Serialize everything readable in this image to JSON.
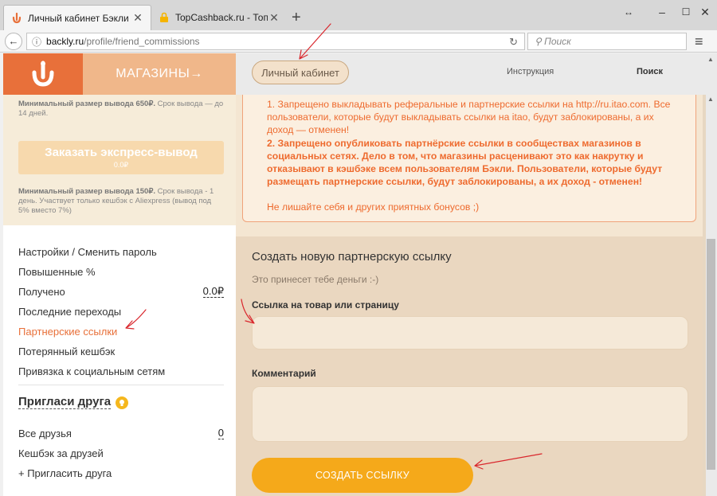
{
  "browser": {
    "tabs": [
      {
        "title": "Личный кабинет Бэкли",
        "active": true
      },
      {
        "title": "TopCashback.ru - Топ лу...",
        "active": false
      }
    ],
    "url_host": "backly.ru",
    "url_path": "/profile/friend_commissions",
    "search_placeholder": "Поиск"
  },
  "header": {
    "logo_glyph": "ᒍ",
    "stores_label": "МАГАЗИНЫ→",
    "nav": {
      "cabinet": "Личный кабинет",
      "instructions": "Инструкция",
      "search": "Поиск"
    }
  },
  "sidebar": {
    "note_top_bold": "Минимальный размер вывода 650₽.",
    "note_top_rest": " Срок вывода — до 14 дней.",
    "express_button": "Заказать экспресс-вывод",
    "express_amount": "0.0₽",
    "note_bottom_bold": "Минимальный размер вывода 150₽.",
    "note_bottom_rest": " Срок вывода - 1 день. Участвует только кешбэк с Aliexpress (вывод под 5% вместо 7%)",
    "menu": [
      {
        "label": "Настройки / Сменить пароль"
      },
      {
        "label": "Повышенные %"
      },
      {
        "label": "Получено",
        "value": "0.0₽"
      },
      {
        "label": "Последние переходы"
      },
      {
        "label": "Партнерские ссылки",
        "active": true
      },
      {
        "label": "Потерянный кешбэк"
      },
      {
        "label": "Привязка к социальным сетям"
      }
    ],
    "invite_title": "Пригласи друга",
    "invite_menu": [
      {
        "label": "Все друзья",
        "value": "0"
      },
      {
        "label": "Кешбэк за друзей"
      },
      {
        "label": "+ Пригласить друга"
      }
    ]
  },
  "notice": {
    "rule1": "1. Запрещено выкладывать реферальные и партнерские ссылки на http://ru.itao.com. Все пользователи, которые будут выкладывать ссылки на itao, будут заблокированы, а их доход — отменен!",
    "rule2": "2. Запрещено опубликовать партнёрские ссылки в сообществах магазинов в социальных сетях. Дело в том, что магазины расценивают это как накрутку и отказывают в кэшбэке всем пользователям Бэкли. Пользователи, которые будут размещать партнерские ссылки, будут заблокированы, а их доход - отменен!",
    "closing": "Не лишайте себя и других приятных бонусов ;)"
  },
  "form": {
    "title": "Создать новую партнерскую ссылку",
    "subtitle": "Это принесет тебе деньги :-)",
    "link_label": "Ссылка на товар или страницу",
    "link_value": "",
    "comment_label": "Комментарий",
    "comment_value": "",
    "submit_label": "СОЗДАТЬ ССЫЛКУ"
  },
  "colors": {
    "brand_orange": "#e8703a",
    "button_yellow": "#f5a91a",
    "annotation_red": "#d9262c"
  }
}
